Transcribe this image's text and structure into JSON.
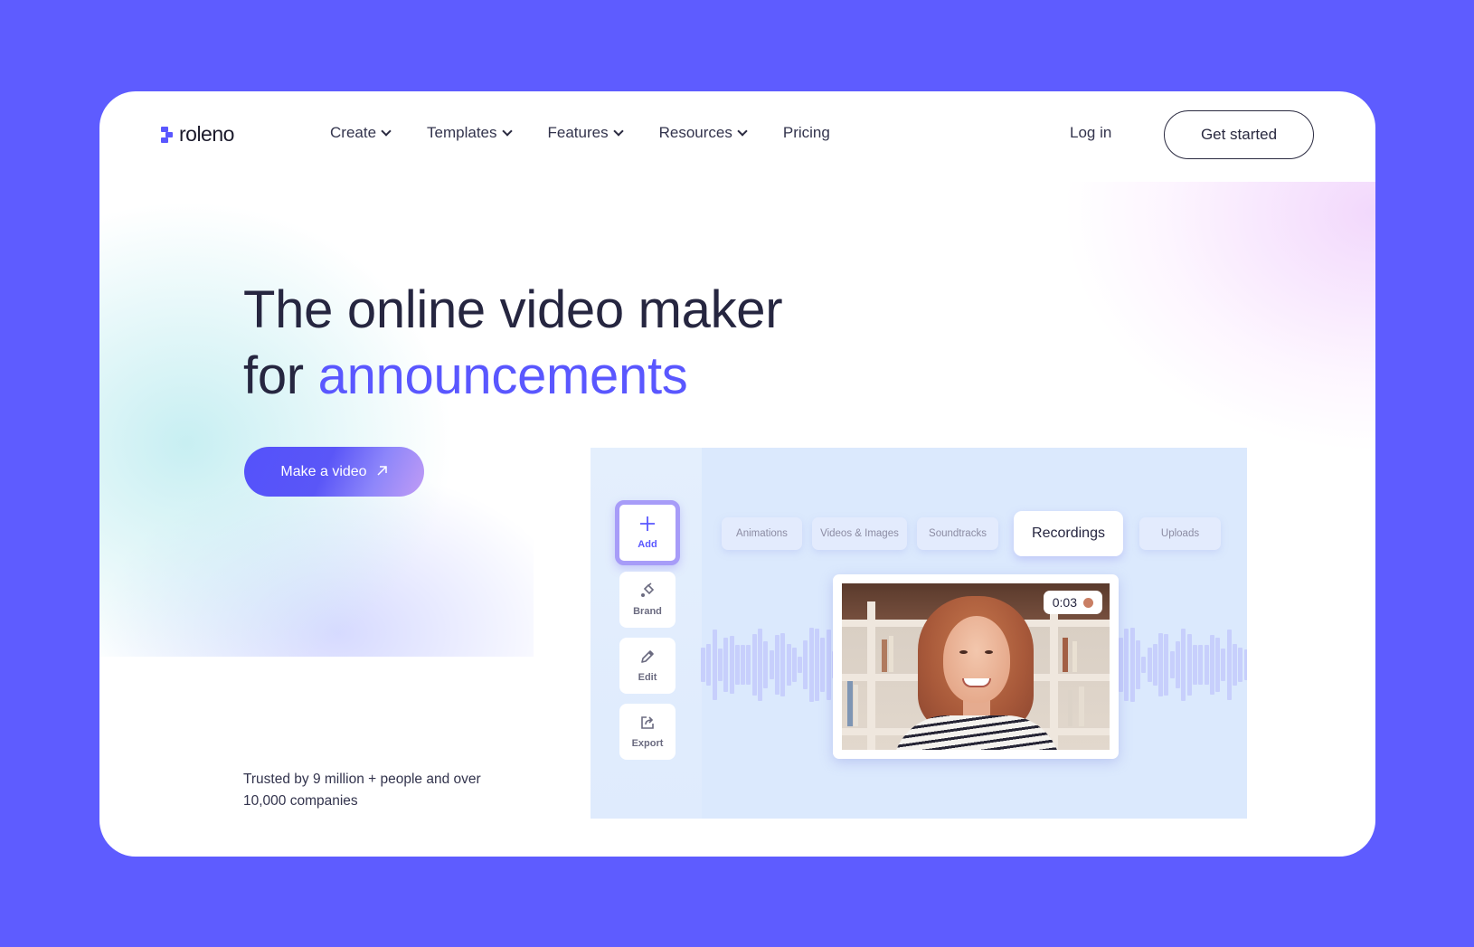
{
  "brand": {
    "name": "roleno",
    "accent_color": "#5a57ff",
    "page_background": "#5e5cff"
  },
  "nav": {
    "items": [
      {
        "label": "Create",
        "has_dropdown": true
      },
      {
        "label": "Templates",
        "has_dropdown": true
      },
      {
        "label": "Features",
        "has_dropdown": true
      },
      {
        "label": "Resources",
        "has_dropdown": true
      },
      {
        "label": "Pricing",
        "has_dropdown": false
      }
    ],
    "login_label": "Log in",
    "cta_label": "Get started"
  },
  "hero": {
    "headline_line1": "The online video maker",
    "headline_line2_prefix": "for",
    "headline_accent": "announcements",
    "cta_label": "Make a video",
    "cta_icon": "arrow-up-right-icon",
    "trust_text": "Trusted by 9 million + people and over 10,000 companies"
  },
  "editor": {
    "tools": [
      {
        "label": "Add",
        "icon": "plus-icon",
        "active": true
      },
      {
        "label": "Brand",
        "icon": "paint-bucket-icon",
        "active": false
      },
      {
        "label": "Edit",
        "icon": "pencil-icon",
        "active": false
      },
      {
        "label": "Export",
        "icon": "export-icon",
        "active": false
      }
    ],
    "tabs": [
      {
        "label": "Animations",
        "active": false
      },
      {
        "label": "Videos & Images",
        "active": false
      },
      {
        "label": "Soundtracks",
        "active": false
      },
      {
        "label": "Recordings",
        "active": true
      },
      {
        "label": "Uploads",
        "active": false
      }
    ],
    "recording": {
      "timer": "0:03",
      "status": "recording",
      "dot_color": "#c97e63"
    }
  }
}
